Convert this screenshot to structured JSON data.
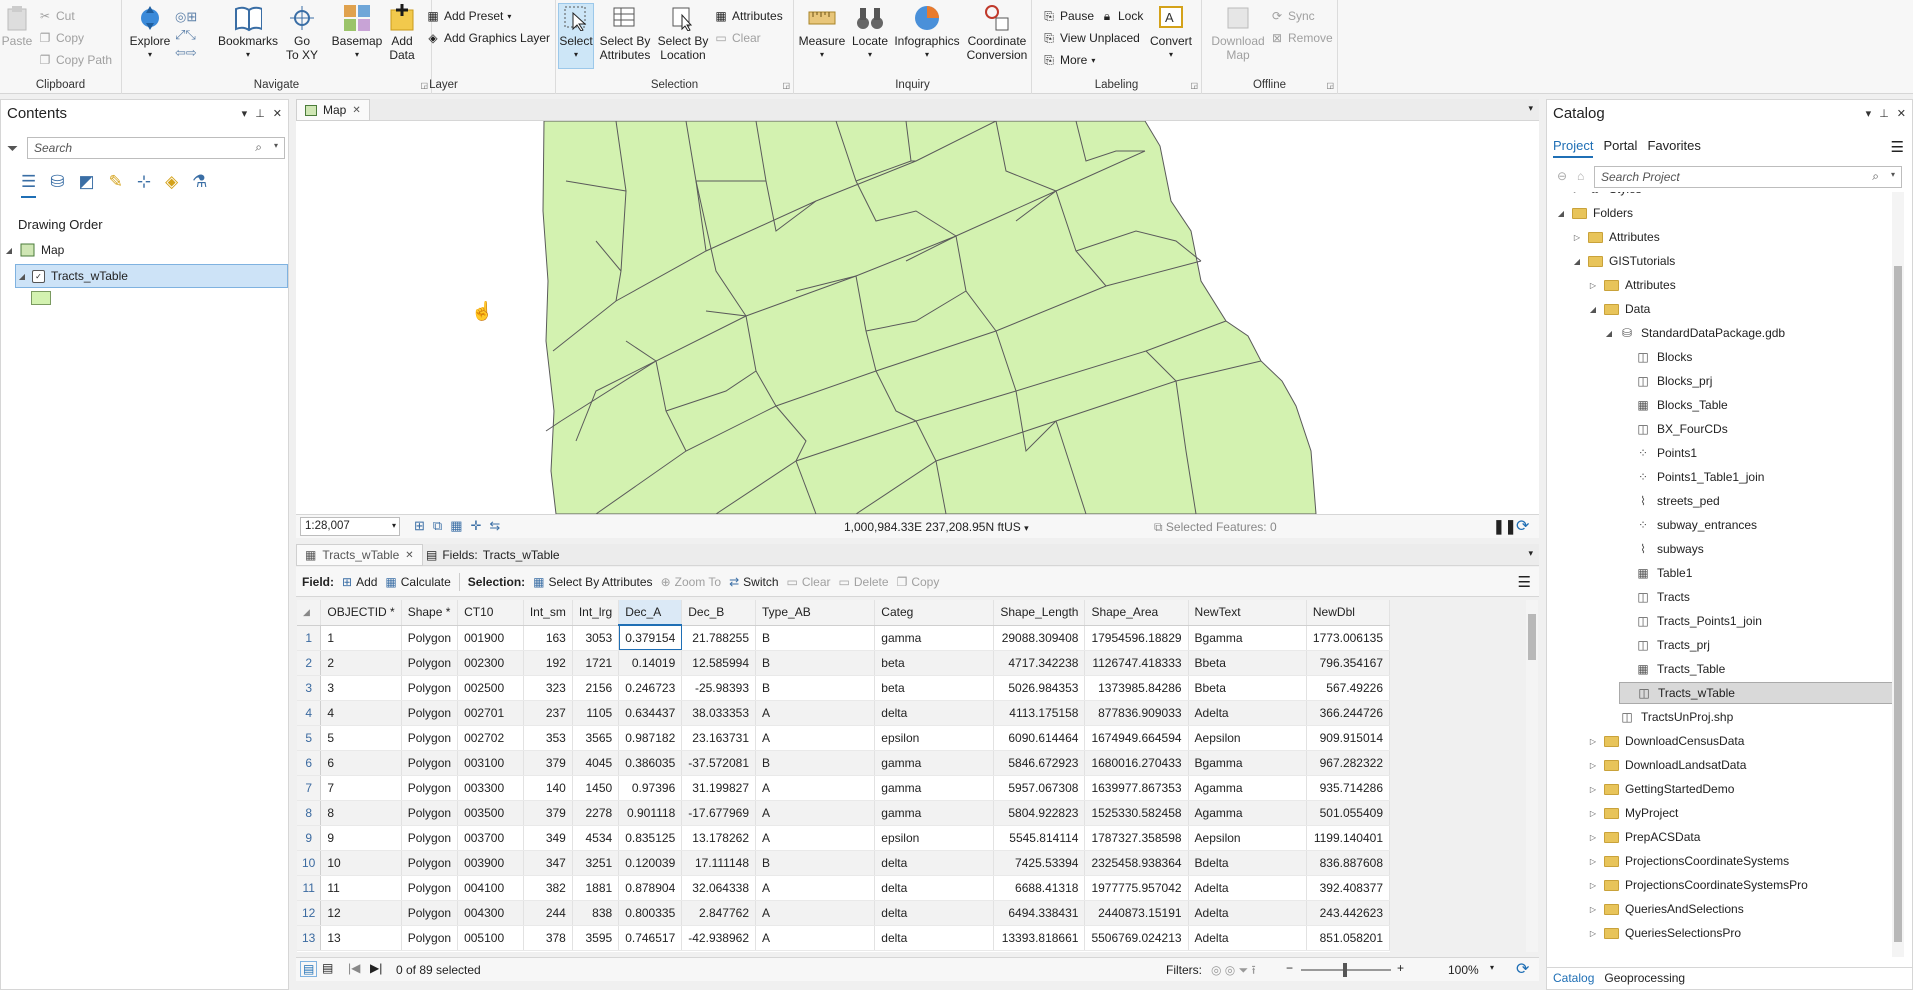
{
  "ribbon": {
    "clipboard": {
      "label": "Clipboard",
      "paste": "Paste",
      "cut": "Cut",
      "copy": "Copy",
      "copy_path": "Copy Path"
    },
    "navigate": {
      "label": "Navigate",
      "explore": "Explore",
      "bookmarks": "Bookmarks",
      "goto_xy": "Go\nTo XY"
    },
    "layer": {
      "label": "Layer",
      "basemap": "Basemap",
      "add_data": "Add\nData",
      "add_preset": "Add Preset",
      "add_graphics_layer": "Add Graphics Layer"
    },
    "selection": {
      "label": "Selection",
      "select": "Select",
      "select_by_attributes": "Select By\nAttributes",
      "select_by_location": "Select By\nLocation",
      "attributes": "Attributes",
      "clear": "Clear"
    },
    "inquiry": {
      "label": "Inquiry",
      "measure": "Measure",
      "locate": "Locate",
      "infographics": "Infographics",
      "coordinate_conversion": "Coordinate\nConversion"
    },
    "labeling": {
      "label": "Labeling",
      "pause": "Pause",
      "lock": "Lock",
      "view_unplaced": "View Unplaced",
      "more": "More",
      "convert": "Convert"
    },
    "offline": {
      "label": "Offline",
      "download_map": "Download\nMap",
      "sync": "Sync",
      "remove": "Remove"
    }
  },
  "contents": {
    "title": "Contents",
    "search_placeholder": "Search",
    "drawing_order": "Drawing Order",
    "map": "Map",
    "layer": "Tracts_wTable"
  },
  "map_view": {
    "tab": "Map",
    "scale": "1:28,007",
    "coords": "1,000,984.33E 237,208.95N ftUS",
    "selected_features": "Selected Features: 0"
  },
  "table_view": {
    "tab1": "Tracts_wTable",
    "tab2_prefix": "Fields:",
    "tab2": "Tracts_wTable",
    "field_label": "Field:",
    "add": "Add",
    "calculate": "Calculate",
    "selection_label": "Selection:",
    "select_by_attributes": "Select By Attributes",
    "zoom_to": "Zoom To",
    "switch": "Switch",
    "clear": "Clear",
    "delete": "Delete",
    "copy": "Copy",
    "status": "0 of 89 selected",
    "filters": "Filters:",
    "zoom": "100%",
    "columns": [
      "OBJECTID *",
      "Shape *",
      "CT10",
      "Int_sm",
      "Int_lrg",
      "Dec_A",
      "Dec_B",
      "Type_AB",
      "Categ",
      "Shape_Length",
      "Shape_Area",
      "NewText",
      "NewDbl"
    ],
    "rows": [
      [
        "1",
        "1",
        "Polygon",
        "001900",
        "163",
        "3053",
        "0.379154",
        "21.788255",
        "B",
        "gamma",
        "29088.309408",
        "17954596.18829",
        "Bgamma",
        "1773.006135"
      ],
      [
        "2",
        "2",
        "Polygon",
        "002300",
        "192",
        "1721",
        "0.14019",
        "12.585994",
        "B",
        "beta",
        "4717.342238",
        "1126747.418333",
        "Bbeta",
        "796.354167"
      ],
      [
        "3",
        "3",
        "Polygon",
        "002500",
        "323",
        "2156",
        "0.246723",
        "-25.98393",
        "B",
        "beta",
        "5026.984353",
        "1373985.84286",
        "Bbeta",
        "567.49226"
      ],
      [
        "4",
        "4",
        "Polygon",
        "002701",
        "237",
        "1105",
        "0.634437",
        "38.033353",
        "A",
        "delta",
        "4113.175158",
        "877836.909033",
        "Adelta",
        "366.244726"
      ],
      [
        "5",
        "5",
        "Polygon",
        "002702",
        "353",
        "3565",
        "0.987182",
        "23.163731",
        "A",
        "epsilon",
        "6090.614464",
        "1674949.664594",
        "Aepsilon",
        "909.915014"
      ],
      [
        "6",
        "6",
        "Polygon",
        "003100",
        "379",
        "4045",
        "0.386035",
        "-37.572081",
        "B",
        "gamma",
        "5846.672923",
        "1680016.270433",
        "Bgamma",
        "967.282322"
      ],
      [
        "7",
        "7",
        "Polygon",
        "003300",
        "140",
        "1450",
        "0.97396",
        "31.199827",
        "A",
        "gamma",
        "5957.067308",
        "1639977.867353",
        "Agamma",
        "935.714286"
      ],
      [
        "8",
        "8",
        "Polygon",
        "003500",
        "379",
        "2278",
        "0.901118",
        "-17.677969",
        "A",
        "gamma",
        "5804.922823",
        "1525330.582458",
        "Agamma",
        "501.055409"
      ],
      [
        "9",
        "9",
        "Polygon",
        "003700",
        "349",
        "4534",
        "0.835125",
        "13.178262",
        "A",
        "epsilon",
        "5545.814114",
        "1787327.358598",
        "Aepsilon",
        "1199.140401"
      ],
      [
        "10",
        "10",
        "Polygon",
        "003900",
        "347",
        "3251",
        "0.120039",
        "17.111148",
        "B",
        "delta",
        "7425.53394",
        "2325458.938364",
        "Bdelta",
        "836.887608"
      ],
      [
        "11",
        "11",
        "Polygon",
        "004100",
        "382",
        "1881",
        "0.878904",
        "32.064338",
        "A",
        "delta",
        "6688.41318",
        "1977775.957042",
        "Adelta",
        "392.408377"
      ],
      [
        "12",
        "12",
        "Polygon",
        "004300",
        "244",
        "838",
        "0.800335",
        "2.847762",
        "A",
        "delta",
        "6494.338431",
        "2440873.15191",
        "Adelta",
        "243.442623"
      ],
      [
        "13",
        "13",
        "Polygon",
        "005100",
        "378",
        "3595",
        "0.746517",
        "-42.938962",
        "A",
        "delta",
        "13393.818661",
        "5506769.024213",
        "Adelta",
        "851.058201"
      ]
    ]
  },
  "catalog": {
    "title": "Catalog",
    "tabs": [
      "Project",
      "Portal",
      "Favorites"
    ],
    "search_placeholder": "Search Project",
    "items": [
      "Styles",
      "Folders",
      "Attributes",
      "GISTutorials",
      "Attributes",
      "Data",
      "StandardDataPackage.gdb",
      "Blocks",
      "Blocks_prj",
      "Blocks_Table",
      "BX_FourCDs",
      "Points1",
      "Points1_Table1_join",
      "streets_ped",
      "subway_entrances",
      "subways",
      "Table1",
      "Tracts",
      "Tracts_Points1_join",
      "Tracts_prj",
      "Tracts_Table",
      "Tracts_wTable",
      "TractsUnProj.shp",
      "DownloadCensusData",
      "DownloadLandsatData",
      "GettingStartedDemo",
      "MyProject",
      "PrepACSData",
      "ProjectionsCoordinateSystems",
      "ProjectionsCoordinateSystemsPro",
      "QueriesAndSelections",
      "QueriesSelectionsPro"
    ],
    "bottom_tabs": [
      "Catalog",
      "Geoprocessing"
    ]
  },
  "colors": {
    "accent": "#1f6fb5",
    "polygon_fill": "#d3f2b0",
    "selected_row": "#cde3f7",
    "ribbon_selected": "#cde6f7"
  }
}
